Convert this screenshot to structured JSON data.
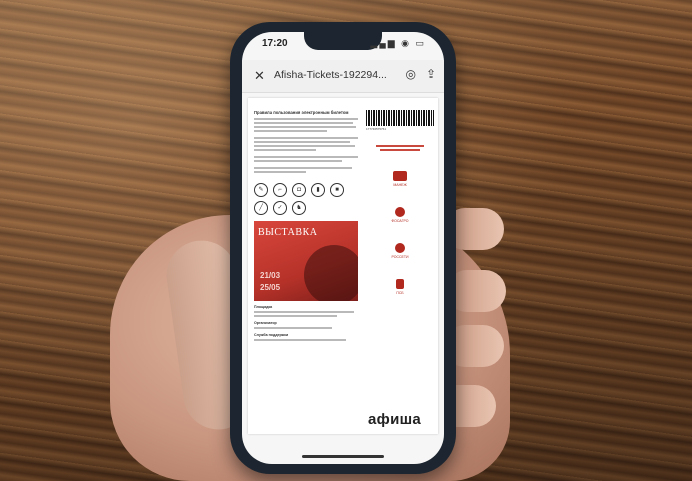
{
  "phone": {
    "status_time": "17:20",
    "status_icons": "▂▄▆ ◉ ▭"
  },
  "navbar": {
    "close_symbol": "✕",
    "title": "Afisha-Tickets-192294...",
    "action1_symbol": "◎",
    "action2_symbol": "⇪"
  },
  "ticket": {
    "heading": "Правила пользования электронным билетом",
    "poster_title": "ВЫСТАВКА",
    "poster_dates": [
      "21/03",
      "25/05"
    ],
    "barcode_number": "177746575761",
    "logo": "афиша",
    "sponsors": [
      "МАНЕЖ",
      "ФОСАГРО",
      "РОССЕТИ",
      "ПСБ"
    ],
    "sections": [
      "Площадка",
      "Организатор",
      "Служба поддержки"
    ]
  },
  "icons": [
    "knife-icon",
    "gun-icon",
    "camera-icon",
    "bottle-icon",
    "projector-icon",
    "syringe-icon",
    "flash-icon",
    "dog-icon"
  ],
  "colors": {
    "poster_red": "#c9392f",
    "phone_frame": "#1d2630",
    "wood": "#7a4d2b"
  }
}
